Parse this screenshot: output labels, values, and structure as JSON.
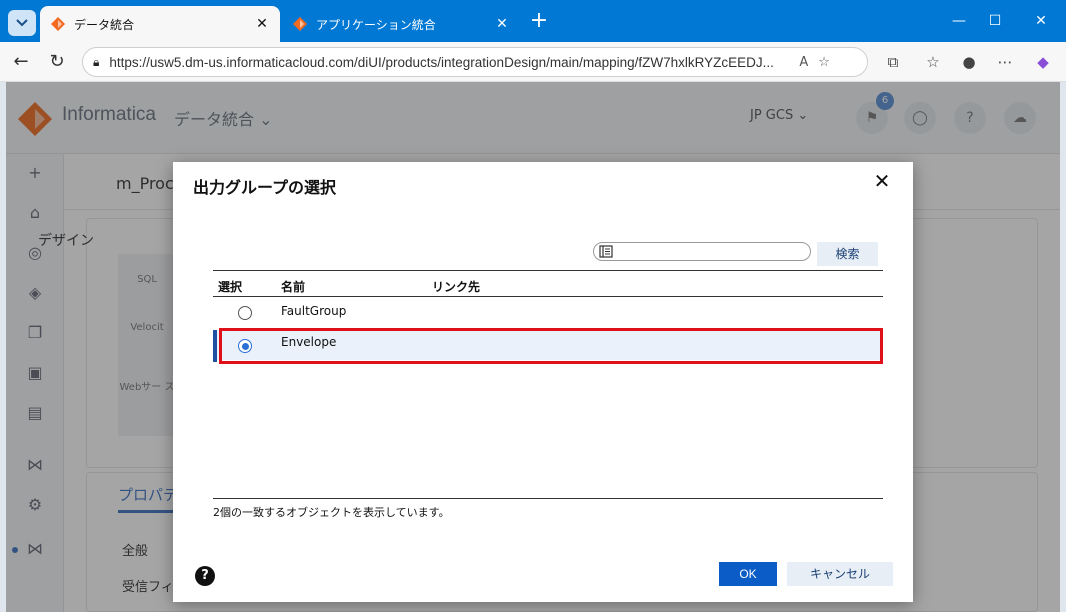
{
  "browser": {
    "tabs": [
      {
        "title": "データ統合"
      },
      {
        "title": "アプリケーション統合"
      }
    ],
    "url": "https://usw5.dm-us.informaticacloud.com/diUI/products/integrationDesign/main/mapping/fZW7hxlkRYZcEEDJ...",
    "new_tab": "+"
  },
  "app": {
    "brand": "Informatica",
    "module": "データ統合",
    "org": "JP GCS",
    "notification_count": "6",
    "mapping_name": "m_Proc",
    "design_title": "デザイン",
    "palette": [
      "SQL",
      "Velocit",
      "Webサー ス"
    ],
    "properties_tab": "プロパテ",
    "prop_labels": [
      "全般",
      "受信フィ"
    ]
  },
  "dialog": {
    "title": "出力グループの選択",
    "search_button": "検索",
    "search_placeholder": "",
    "columns": {
      "select": "選択",
      "name": "名前",
      "link_to": "リンク先"
    },
    "rows": [
      {
        "name": "FaultGroup",
        "selected": false,
        "link_to": ""
      },
      {
        "name": "Envelope",
        "selected": true,
        "link_to": ""
      }
    ],
    "status": "2個の一致するオブジェクトを表示しています。",
    "help": "?",
    "ok": "OK",
    "cancel": "キャンセル"
  },
  "colors": {
    "browser_accent": "#0078d4",
    "primary_button": "#0b5cc7",
    "highlight": "#e0101a",
    "selected_row": "#eaf1fb"
  }
}
